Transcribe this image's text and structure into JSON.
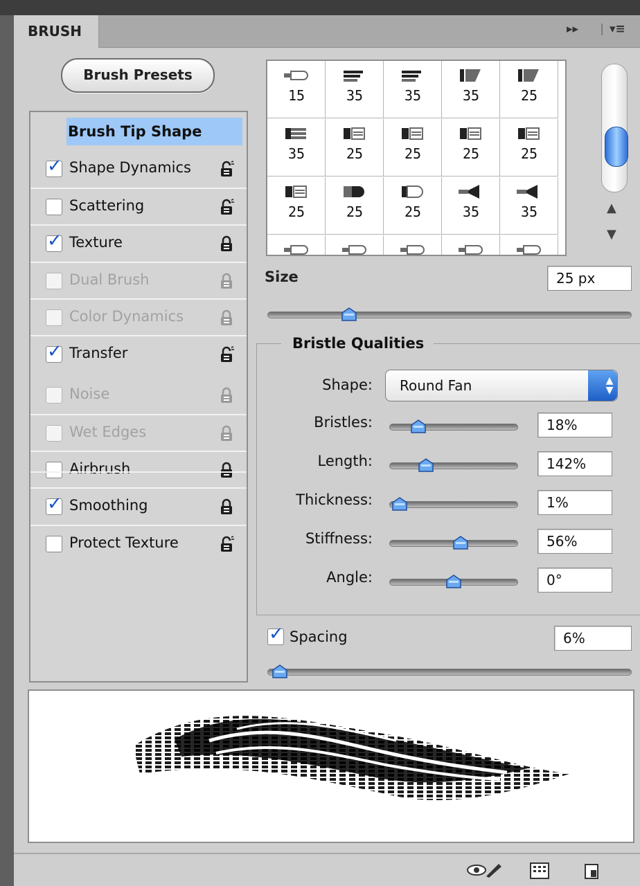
{
  "tab": {
    "title": "BRUSH",
    "controls": [
      "▸▸",
      "|",
      "▾≡"
    ]
  },
  "presets_button": "Brush Presets",
  "options": {
    "brush_tip_shape": "Brush Tip Shape",
    "items": [
      {
        "label": "Shape Dynamics",
        "checked": true,
        "enabled": true,
        "lock": "unlocked"
      },
      {
        "label": "Scattering",
        "checked": false,
        "enabled": true,
        "lock": "unlocked"
      },
      {
        "label": "Texture",
        "checked": true,
        "enabled": true,
        "lock": "locked"
      },
      {
        "label": "Dual Brush",
        "checked": false,
        "enabled": false,
        "lock": "locked"
      },
      {
        "label": "Color Dynamics",
        "checked": false,
        "enabled": false,
        "lock": "locked"
      },
      {
        "label": "Transfer",
        "checked": true,
        "enabled": true,
        "lock": "unlocked"
      },
      {
        "label": "Noise",
        "checked": false,
        "enabled": false,
        "lock": "locked"
      },
      {
        "label": "Wet Edges",
        "checked": false,
        "enabled": false,
        "lock": "locked"
      },
      {
        "label": "Airbrush",
        "checked": false,
        "enabled": true,
        "lock": "locked"
      },
      {
        "label": "Smoothing",
        "checked": true,
        "enabled": true,
        "lock": "locked"
      },
      {
        "label": "Protect Texture",
        "checked": false,
        "enabled": true,
        "lock": "unlocked"
      }
    ]
  },
  "presets_grid": {
    "rows": [
      [
        {
          "size": "15",
          "icon": "round-bristle-icon"
        },
        {
          "size": "35",
          "icon": "flat-bristle-icon"
        },
        {
          "size": "35",
          "icon": "flat-bristle-icon"
        },
        {
          "size": "35",
          "icon": "angle-bristle-icon"
        },
        {
          "size": "25",
          "icon": "angle-bristle-icon"
        }
      ],
      [
        {
          "size": "35",
          "icon": "flat-point-icon"
        },
        {
          "size": "25",
          "icon": "flat-blunt-icon"
        },
        {
          "size": "25",
          "icon": "flat-blunt-icon"
        },
        {
          "size": "25",
          "icon": "flat-blunt-icon"
        },
        {
          "size": "25",
          "icon": "flat-blunt-icon"
        }
      ],
      [
        {
          "size": "25",
          "icon": "flat-blunt-icon"
        },
        {
          "size": "25",
          "icon": "round-blunt-icon"
        },
        {
          "size": "25",
          "icon": "round-curve-icon"
        },
        {
          "size": "35",
          "icon": "fan-icon"
        },
        {
          "size": "35",
          "icon": "fan-icon"
        }
      ],
      [
        {
          "size": "",
          "icon": "round-bristle-icon"
        },
        {
          "size": "",
          "icon": "round-bristle-icon"
        },
        {
          "size": "",
          "icon": "round-bristle-icon"
        },
        {
          "size": "",
          "icon": "round-bristle-icon"
        },
        {
          "size": "",
          "icon": "round-bristle-icon"
        }
      ]
    ],
    "scroll_position": 0.7
  },
  "size": {
    "label": "Size",
    "value": "25 px",
    "slider": 0.21
  },
  "bristle_qualities": {
    "title": "Bristle Qualities",
    "shape": {
      "label": "Shape:",
      "value": "Round Fan"
    },
    "params": [
      {
        "label": "Bristles:",
        "value": "18%",
        "slider": 0.18
      },
      {
        "label": "Length:",
        "value": "142%",
        "slider": 0.25
      },
      {
        "label": "Thickness:",
        "value": "1%",
        "slider": 0.01
      },
      {
        "label": "Stiffness:",
        "value": "56%",
        "slider": 0.56
      },
      {
        "label": "Angle:",
        "value": "0°",
        "slider": 0.5
      }
    ]
  },
  "spacing": {
    "label": "Spacing",
    "checked": true,
    "value": "6%",
    "slider": 0.01
  },
  "accent_color": "#9ec8f7",
  "check_color": "#1a55c5"
}
